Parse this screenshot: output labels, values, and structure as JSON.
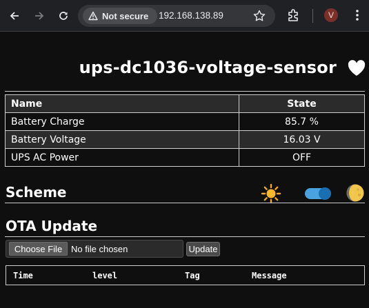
{
  "browser": {
    "security_label": "Not secure",
    "url": "192.168.138.89",
    "avatar_initial": "V"
  },
  "page": {
    "title": "ups-dc1036-voltage-sensor",
    "states_table": {
      "headers": [
        "Name",
        "State"
      ],
      "rows": [
        {
          "name": "Battery Charge",
          "state": "85.7 %"
        },
        {
          "name": "Battery Voltage",
          "state": "16.03 V"
        },
        {
          "name": "UPS AC Power",
          "state": "OFF"
        }
      ]
    },
    "scheme": {
      "title": "Scheme",
      "dark_mode": true
    },
    "ota": {
      "title": "OTA Update",
      "choose_file_label": "Choose File",
      "file_status": "No file chosen",
      "update_label": "Update"
    },
    "log_table": {
      "headers": [
        "Time",
        "level",
        "Tag",
        "Message"
      ]
    }
  }
}
